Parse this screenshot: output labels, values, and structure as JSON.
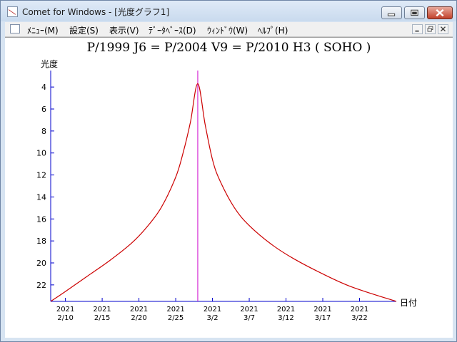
{
  "window": {
    "title": "Comet for Windows - [光度グラフ1]"
  },
  "menu": [
    "ﾒﾆｭｰ(M)",
    "設定(S)",
    "表示(V)",
    "ﾃﾞｰﾀﾍﾞｰｽ(D)",
    "ｳｨﾝﾄﾞｳ(W)",
    "ﾍﾙﾌﾟ(H)"
  ],
  "icons": {
    "app": "comet-app-icon",
    "window_controls": [
      "minimize-icon",
      "maximize-icon",
      "close-icon"
    ],
    "mdi_controls": [
      "mdi-minimize-icon",
      "mdi-restore-icon",
      "mdi-close-icon"
    ]
  },
  "colors": {
    "axis": "#0000cc",
    "curve": "#cc0000",
    "marker": "#cc00cc"
  },
  "chart_data": {
    "type": "line",
    "title": "P/1999 J6 = P/2004 V9 = P/2010 H3 ( SOHO )",
    "ylabel": "光度",
    "xlabel": "日付",
    "y_inverted": true,
    "ylim": [
      23.5,
      2.5
    ],
    "y_ticks": [
      "4",
      "6",
      "8",
      "10",
      "12",
      "14",
      "16",
      "18",
      "20",
      "22"
    ],
    "x_ticks": [
      {
        "year": "2021",
        "date": "2/10"
      },
      {
        "year": "2021",
        "date": "2/15"
      },
      {
        "year": "2021",
        "date": "2/20"
      },
      {
        "year": "2021",
        "date": "2/25"
      },
      {
        "year": "2021",
        "date": "3/2"
      },
      {
        "year": "2021",
        "date": "3/7"
      },
      {
        "year": "2021",
        "date": "3/12"
      },
      {
        "year": "2021",
        "date": "3/17"
      },
      {
        "year": "2021",
        "date": "3/22"
      }
    ],
    "xlim": [
      "2021-02-08",
      "2021-03-27"
    ],
    "vertical_marker": "2021-02-28",
    "series": [
      {
        "x": [
          "2021-02-08",
          "2021-02-10",
          "2021-02-13",
          "2021-02-16",
          "2021-02-19",
          "2021-02-21",
          "2021-02-23",
          "2021-02-25",
          "2021-02-26",
          "2021-02-27",
          "2021-02-28",
          "2021-03-01",
          "2021-03-02",
          "2021-03-03",
          "2021-03-05",
          "2021-03-07",
          "2021-03-10",
          "2021-03-13",
          "2021-03-17",
          "2021-03-21",
          "2021-03-27"
        ],
        "y": [
          23.5,
          22.6,
          21.2,
          19.8,
          18.2,
          16.8,
          15.0,
          12.2,
          10.0,
          7.2,
          3.7,
          7.4,
          10.6,
          12.5,
          15.0,
          16.6,
          18.3,
          19.6,
          21.0,
          22.2,
          23.5
        ]
      }
    ]
  }
}
